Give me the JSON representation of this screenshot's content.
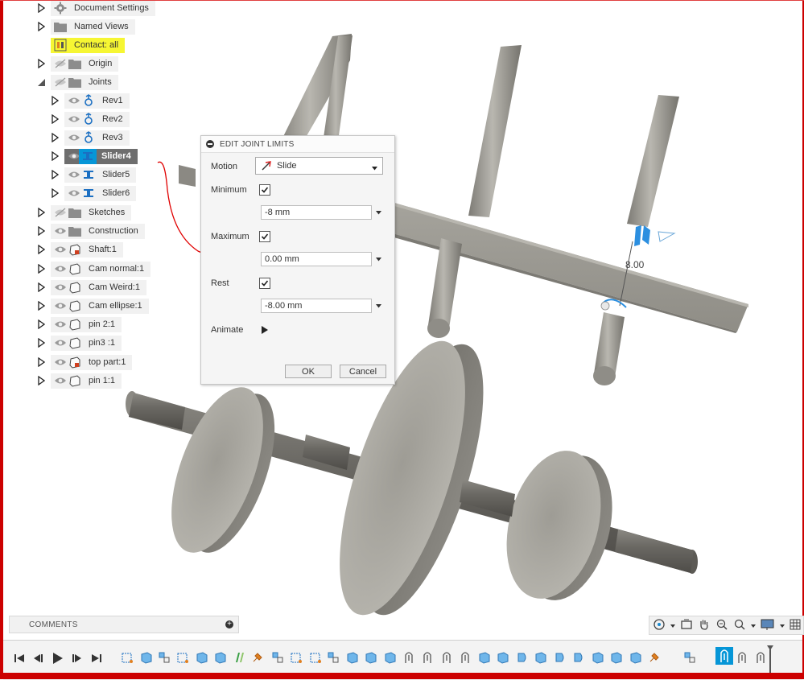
{
  "browser": {
    "items": [
      {
        "label": "Document Settings",
        "icon": "gear-icon",
        "expand": "closed",
        "eye": "none",
        "indent": 0
      },
      {
        "label": "Named Views",
        "icon": "folder-icon",
        "expand": "closed",
        "eye": "none",
        "indent": 0
      },
      {
        "label": "Contact: all",
        "icon": "contact-set-icon",
        "expand": "none",
        "eye": "none",
        "indent": 0,
        "highlight": true
      },
      {
        "label": "Origin",
        "icon": "folder-icon",
        "expand": "closed",
        "eye": "hidden",
        "indent": 0
      },
      {
        "label": "Joints",
        "icon": "folder-icon",
        "expand": "open",
        "eye": "hidden",
        "indent": 0
      },
      {
        "label": "Rev1",
        "icon": "revolute-joint-icon",
        "expand": "closed",
        "eye": "visible",
        "indent": 1
      },
      {
        "label": "Rev2",
        "icon": "revolute-joint-icon",
        "expand": "closed",
        "eye": "visible",
        "indent": 1
      },
      {
        "label": "Rev3",
        "icon": "revolute-joint-icon",
        "expand": "closed",
        "eye": "visible",
        "indent": 1
      },
      {
        "label": "Slider4",
        "icon": "slider-joint-icon",
        "expand": "closed",
        "eye": "visible",
        "indent": 1,
        "selected": true
      },
      {
        "label": "Slider5",
        "icon": "slider-joint-icon",
        "expand": "closed",
        "eye": "visible",
        "indent": 1
      },
      {
        "label": "Slider6",
        "icon": "slider-joint-icon",
        "expand": "closed",
        "eye": "visible",
        "indent": 1
      },
      {
        "label": "Sketches",
        "icon": "folder-icon",
        "expand": "closed",
        "eye": "hidden",
        "indent": 0
      },
      {
        "label": "Construction",
        "icon": "folder-icon",
        "expand": "closed",
        "eye": "visible",
        "indent": 0
      },
      {
        "label": "Shaft:1",
        "icon": "component-grounded-icon",
        "expand": "closed",
        "eye": "visible",
        "indent": 0
      },
      {
        "label": "Cam normal:1",
        "icon": "component-icon",
        "expand": "closed",
        "eye": "visible",
        "indent": 0
      },
      {
        "label": "Cam Weird:1",
        "icon": "component-icon",
        "expand": "closed",
        "eye": "visible",
        "indent": 0
      },
      {
        "label": "Cam ellipse:1",
        "icon": "component-icon",
        "expand": "closed",
        "eye": "visible",
        "indent": 0
      },
      {
        "label": "pin 2:1",
        "icon": "component-icon",
        "expand": "closed",
        "eye": "visible",
        "indent": 0
      },
      {
        "label": "pin3 :1",
        "icon": "component-icon",
        "expand": "closed",
        "eye": "visible",
        "indent": 0
      },
      {
        "label": "top part:1",
        "icon": "component-grounded-icon",
        "expand": "closed",
        "eye": "visible",
        "indent": 0
      },
      {
        "label": "pin 1:1",
        "icon": "component-icon",
        "expand": "closed",
        "eye": "visible",
        "indent": 0
      }
    ]
  },
  "dialog": {
    "title": "EDIT JOINT LIMITS",
    "motion_label": "Motion",
    "motion_value": "Slide",
    "minimum_label": "Minimum",
    "minimum_checked": true,
    "minimum_value": "-8 mm",
    "maximum_label": "Maximum",
    "maximum_checked": true,
    "maximum_value": "0.00 mm",
    "rest_label": "Rest",
    "rest_checked": true,
    "rest_value": "-8.00 mm",
    "animate_label": "Animate",
    "ok_label": "OK",
    "cancel_label": "Cancel"
  },
  "viewport": {
    "dimension_label": "8.00"
  },
  "comments": {
    "label": "COMMENTS"
  },
  "colors": {
    "accent": "#0696d7",
    "selected_chip": "#6e6e6e",
    "highlight": "#f6f633",
    "annotation_red": "#e00000",
    "model_gray": "#a8a69e"
  }
}
